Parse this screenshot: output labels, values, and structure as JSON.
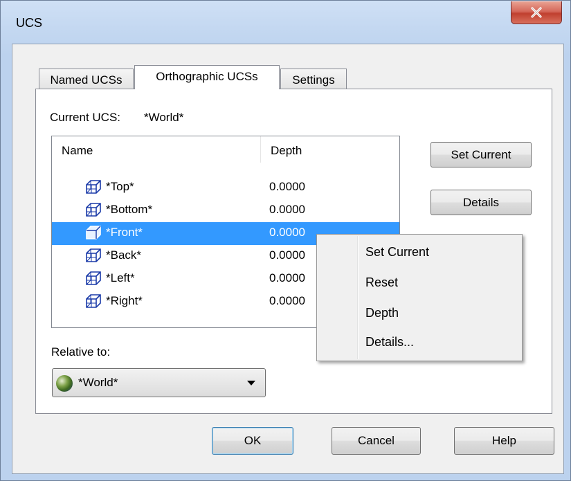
{
  "window": {
    "title": "UCS",
    "close_glyph": "✕"
  },
  "tabs": [
    {
      "label": "Named UCSs",
      "active": false
    },
    {
      "label": "Orthographic UCSs",
      "active": true
    },
    {
      "label": "Settings",
      "active": false
    }
  ],
  "current_ucs": {
    "label": "Current UCS:",
    "value": "*World*"
  },
  "list": {
    "columns": [
      "Name",
      "Depth"
    ],
    "rows": [
      {
        "name": "*Top*",
        "depth": "0.0000",
        "selected": false
      },
      {
        "name": "*Bottom*",
        "depth": "0.0000",
        "selected": false
      },
      {
        "name": "*Front*",
        "depth": "0.0000",
        "selected": true
      },
      {
        "name": "*Back*",
        "depth": "0.0000",
        "selected": false
      },
      {
        "name": "*Left*",
        "depth": "0.0000",
        "selected": false
      },
      {
        "name": "*Right*",
        "depth": "0.0000",
        "selected": false
      }
    ],
    "row_icon": "ucs-cube-icon"
  },
  "side_buttons": {
    "set_current": "Set Current",
    "details": "Details"
  },
  "relative_to": {
    "label": "Relative to:",
    "value": "*World*",
    "icon": "globe-icon"
  },
  "context_menu": {
    "items": [
      "Set Current",
      "Reset",
      "Depth",
      "Details..."
    ]
  },
  "footer": {
    "ok": "OK",
    "cancel": "Cancel",
    "help": "Help"
  },
  "colors": {
    "selection": "#3399ff",
    "close_button": "#c7463a"
  }
}
